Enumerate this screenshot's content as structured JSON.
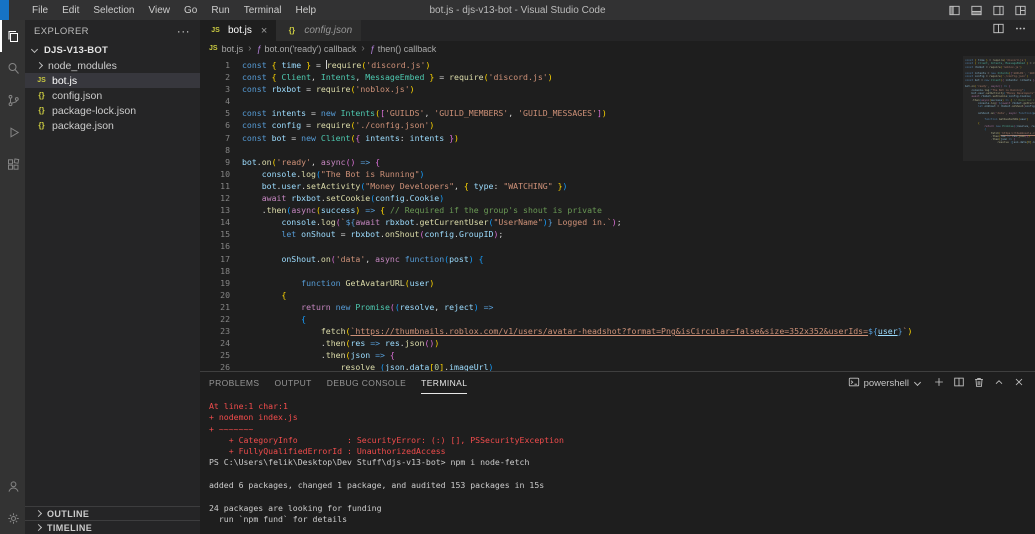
{
  "title_bar": {
    "title": "bot.js - djs-v13-bot - Visual Studio Code",
    "menus": [
      "File",
      "Edit",
      "Selection",
      "View",
      "Go",
      "Run",
      "Terminal",
      "Help"
    ]
  },
  "activity_bar": {
    "items": [
      "explorer",
      "search",
      "source-control",
      "run-and-debug",
      "extensions"
    ],
    "bottom_items": [
      "account",
      "settings"
    ],
    "active": "explorer"
  },
  "explorer": {
    "header": "EXPLORER",
    "root": "DJS-V13-BOT",
    "files": [
      {
        "label": "node_modules",
        "icon": "chevron",
        "selected": false
      },
      {
        "label": "bot.js",
        "icon": "js",
        "selected": true
      },
      {
        "label": "config.json",
        "icon": "json",
        "selected": false
      },
      {
        "label": "package-lock.json",
        "icon": "json",
        "selected": false
      },
      {
        "label": "package.json",
        "icon": "json",
        "selected": false
      }
    ],
    "bottom_sections": [
      "OUTLINE",
      "TIMELINE"
    ]
  },
  "tabs": [
    {
      "label": "bot.js",
      "icon": "js",
      "active": true
    },
    {
      "label": "config.json",
      "icon": "json",
      "active": false
    }
  ],
  "breadcrumb": [
    "bot.js",
    "bot.on('ready') callback",
    "then() callback"
  ],
  "editor": {
    "lines": [
      {
        "n": 1,
        "indent": 0,
        "tokens": [
          [
            "kw",
            "const "
          ],
          [
            "b1",
            "{"
          ],
          [
            "var",
            " time "
          ],
          [
            "b1",
            "}"
          ],
          [
            "pl",
            " = "
          ],
          [
            "cur",
            ""
          ],
          [
            "fn",
            "require"
          ],
          [
            "b1",
            "("
          ],
          [
            "str",
            "'discord.js'"
          ],
          [
            "b1",
            ")"
          ]
        ]
      },
      {
        "n": 2,
        "indent": 0,
        "tokens": [
          [
            "kw",
            "const "
          ],
          [
            "b1",
            "{"
          ],
          [
            "pl",
            " "
          ],
          [
            "cls",
            "Client"
          ],
          [
            "pl",
            ", "
          ],
          [
            "cls",
            "Intents"
          ],
          [
            "pl",
            ", "
          ],
          [
            "cls",
            "MessageEmbed"
          ],
          [
            "pl",
            " "
          ],
          [
            "b1",
            "}"
          ],
          [
            "pl",
            " = "
          ],
          [
            "fn",
            "require"
          ],
          [
            "b1",
            "("
          ],
          [
            "str",
            "'discord.js'"
          ],
          [
            "b1",
            ")"
          ]
        ]
      },
      {
        "n": 3,
        "indent": 0,
        "tokens": [
          [
            "kw",
            "const "
          ],
          [
            "var",
            "rbxbot"
          ],
          [
            "pl",
            " = "
          ],
          [
            "fn",
            "require"
          ],
          [
            "b1",
            "("
          ],
          [
            "str",
            "'noblox.js'"
          ],
          [
            "b1",
            ")"
          ]
        ]
      },
      {
        "n": 4,
        "indent": 0,
        "tokens": []
      },
      {
        "n": 5,
        "indent": 0,
        "tokens": [
          [
            "kw",
            "const "
          ],
          [
            "var",
            "intents"
          ],
          [
            "pl",
            " = "
          ],
          [
            "kw",
            "new "
          ],
          [
            "cls",
            "Intents"
          ],
          [
            "b1",
            "("
          ],
          [
            "b2",
            "["
          ],
          [
            "str",
            "'GUILDS'"
          ],
          [
            "pl",
            ", "
          ],
          [
            "str",
            "'GUILD_MEMBERS'"
          ],
          [
            "pl",
            ", "
          ],
          [
            "str",
            "'GUILD_MESSAGES'"
          ],
          [
            "b2",
            "]"
          ],
          [
            "b1",
            ")"
          ]
        ]
      },
      {
        "n": 6,
        "indent": 0,
        "tokens": [
          [
            "kw",
            "const "
          ],
          [
            "var",
            "config"
          ],
          [
            "pl",
            " = "
          ],
          [
            "fn",
            "require"
          ],
          [
            "b1",
            "("
          ],
          [
            "str",
            "'./config.json'"
          ],
          [
            "b1",
            ")"
          ]
        ]
      },
      {
        "n": 7,
        "indent": 0,
        "tokens": [
          [
            "kw",
            "const "
          ],
          [
            "var",
            "bot"
          ],
          [
            "pl",
            " = "
          ],
          [
            "kw",
            "new "
          ],
          [
            "cls",
            "Client"
          ],
          [
            "b1",
            "("
          ],
          [
            "b2",
            "{"
          ],
          [
            "var",
            " intents"
          ],
          [
            "pl",
            ": "
          ],
          [
            "var",
            "intents"
          ],
          [
            "pl",
            " "
          ],
          [
            "b2",
            "}"
          ],
          [
            "b1",
            ")"
          ]
        ]
      },
      {
        "n": 8,
        "indent": 0,
        "tokens": []
      },
      {
        "n": 9,
        "indent": 0,
        "tokens": [
          [
            "var",
            "bot"
          ],
          [
            "pl",
            "."
          ],
          [
            "fn",
            "on"
          ],
          [
            "b1",
            "("
          ],
          [
            "str",
            "'ready'"
          ],
          [
            "pl",
            ", "
          ],
          [
            "ctl",
            "async"
          ],
          [
            "b2",
            "("
          ],
          [
            "b2",
            ")"
          ],
          [
            "kw",
            " => "
          ],
          [
            "b2",
            "{"
          ]
        ]
      },
      {
        "n": 10,
        "indent": 4,
        "tokens": [
          [
            "var",
            "console"
          ],
          [
            "pl",
            "."
          ],
          [
            "fn",
            "log"
          ],
          [
            "b3",
            "("
          ],
          [
            "str",
            "\"The Bot is Running\""
          ],
          [
            "b3",
            ")"
          ]
        ]
      },
      {
        "n": 11,
        "indent": 4,
        "tokens": [
          [
            "var",
            "bot"
          ],
          [
            "pl",
            "."
          ],
          [
            "var",
            "user"
          ],
          [
            "pl",
            "."
          ],
          [
            "fn",
            "setActivity"
          ],
          [
            "b3",
            "("
          ],
          [
            "str",
            "\"Money Developers\""
          ],
          [
            "pl",
            ", "
          ],
          [
            "b1",
            "{"
          ],
          [
            "var",
            " type"
          ],
          [
            "pl",
            ": "
          ],
          [
            "str",
            "\"WATCHING\""
          ],
          [
            "pl",
            " "
          ],
          [
            "b1",
            "}"
          ],
          [
            "b3",
            ")"
          ]
        ]
      },
      {
        "n": 12,
        "indent": 4,
        "tokens": [
          [
            "ctl",
            "await "
          ],
          [
            "var",
            "rbxbot"
          ],
          [
            "pl",
            "."
          ],
          [
            "fn",
            "setCookie"
          ],
          [
            "b3",
            "("
          ],
          [
            "var",
            "config"
          ],
          [
            "pl",
            "."
          ],
          [
            "var",
            "Cookie"
          ],
          [
            "b3",
            ")"
          ]
        ]
      },
      {
        "n": 13,
        "indent": 4,
        "tokens": [
          [
            "pl",
            "."
          ],
          [
            "fn",
            "then"
          ],
          [
            "b3",
            "("
          ],
          [
            "ctl",
            "async"
          ],
          [
            "b1",
            "("
          ],
          [
            "var",
            "success"
          ],
          [
            "b1",
            ")"
          ],
          [
            "kw",
            " => "
          ],
          [
            "b1",
            "{"
          ],
          [
            "cmt",
            " // Required if the group's shout is private"
          ]
        ]
      },
      {
        "n": 14,
        "indent": 8,
        "tokens": [
          [
            "var",
            "console"
          ],
          [
            "pl",
            "."
          ],
          [
            "fn",
            "log"
          ],
          [
            "b2",
            "("
          ],
          [
            "str",
            "`"
          ],
          [
            "te",
            "${"
          ],
          [
            "ctl",
            "await "
          ],
          [
            "var",
            "rbxbot"
          ],
          [
            "pl",
            "."
          ],
          [
            "fn",
            "getCurrentUser"
          ],
          [
            "b3",
            "("
          ],
          [
            "str",
            "\"UserName\""
          ],
          [
            "b3",
            ")"
          ],
          [
            "te",
            "}"
          ],
          [
            "str",
            " Logged in.`"
          ],
          [
            "b2",
            ")"
          ],
          [
            "pl",
            ";"
          ]
        ]
      },
      {
        "n": 15,
        "indent": 8,
        "tokens": [
          [
            "kw",
            "let "
          ],
          [
            "var",
            "onShout"
          ],
          [
            "pl",
            " = "
          ],
          [
            "var",
            "rbxbot"
          ],
          [
            "pl",
            "."
          ],
          [
            "fn",
            "onShout"
          ],
          [
            "b2",
            "("
          ],
          [
            "var",
            "config"
          ],
          [
            "pl",
            "."
          ],
          [
            "var",
            "GroupID"
          ],
          [
            "b2",
            ")"
          ],
          [
            "pl",
            ";"
          ]
        ]
      },
      {
        "n": 16,
        "indent": 0,
        "tokens": []
      },
      {
        "n": 17,
        "indent": 8,
        "tokens": [
          [
            "var",
            "onShout"
          ],
          [
            "pl",
            "."
          ],
          [
            "fn",
            "on"
          ],
          [
            "b2",
            "("
          ],
          [
            "str",
            "'data'"
          ],
          [
            "pl",
            ", "
          ],
          [
            "ctl",
            "async "
          ],
          [
            "kw",
            "function"
          ],
          [
            "b3",
            "("
          ],
          [
            "var",
            "post"
          ],
          [
            "b3",
            ")"
          ],
          [
            "pl",
            " "
          ],
          [
            "b3",
            "{"
          ]
        ]
      },
      {
        "n": 18,
        "indent": 0,
        "tokens": []
      },
      {
        "n": 19,
        "indent": 12,
        "tokens": [
          [
            "kw",
            "function "
          ],
          [
            "fn",
            "GetAvatarURL"
          ],
          [
            "b1",
            "("
          ],
          [
            "var",
            "user"
          ],
          [
            "b1",
            ")"
          ]
        ]
      },
      {
        "n": 20,
        "indent": 8,
        "tokens": [
          [
            "b1",
            "{"
          ]
        ]
      },
      {
        "n": 21,
        "indent": 12,
        "tokens": [
          [
            "ctl",
            "return "
          ],
          [
            "kw",
            "new "
          ],
          [
            "cls",
            "Promise"
          ],
          [
            "b2",
            "("
          ],
          [
            "b3",
            "("
          ],
          [
            "var",
            "resolve"
          ],
          [
            "pl",
            ", "
          ],
          [
            "var",
            "reject"
          ],
          [
            "b3",
            ")"
          ],
          [
            "kw",
            " =>"
          ]
        ]
      },
      {
        "n": 22,
        "indent": 12,
        "tokens": [
          [
            "b3",
            "{"
          ]
        ]
      },
      {
        "n": 23,
        "indent": 16,
        "tokens": [
          [
            "fn",
            "fetch"
          ],
          [
            "b1",
            "("
          ],
          [
            "strU",
            "`https://thumbnails.roblox.com/v1/users/avatar-headshot?format=Png&isCircular=false&size=352x352&userIds="
          ],
          [
            "te",
            "${"
          ],
          [
            "varU",
            "user"
          ],
          [
            "te",
            "}"
          ],
          [
            "str",
            "`"
          ],
          [
            "b1",
            ")"
          ]
        ]
      },
      {
        "n": 24,
        "indent": 16,
        "tokens": [
          [
            "pl",
            "."
          ],
          [
            "fn",
            "then"
          ],
          [
            "b1",
            "("
          ],
          [
            "var",
            "res"
          ],
          [
            "kw",
            " => "
          ],
          [
            "var",
            "res"
          ],
          [
            "pl",
            "."
          ],
          [
            "fn",
            "json"
          ],
          [
            "b2",
            "("
          ],
          [
            "b2",
            ")"
          ],
          [
            "b1",
            ")"
          ]
        ]
      },
      {
        "n": 25,
        "indent": 16,
        "tokens": [
          [
            "pl",
            "."
          ],
          [
            "fn",
            "then"
          ],
          [
            "b1",
            "("
          ],
          [
            "var",
            "json"
          ],
          [
            "kw",
            " => "
          ],
          [
            "b2",
            "{"
          ]
        ]
      },
      {
        "n": 26,
        "indent": 20,
        "tokens": [
          [
            "fn",
            "resolve"
          ],
          [
            "pl",
            " "
          ],
          [
            "b3",
            "("
          ],
          [
            "var",
            "json"
          ],
          [
            "pl",
            "."
          ],
          [
            "var",
            "data"
          ],
          [
            "b1",
            "["
          ],
          [
            "num",
            "0"
          ],
          [
            "b1",
            "]"
          ],
          [
            "pl",
            "."
          ],
          [
            "var",
            "imageUrl"
          ],
          [
            "b3",
            ")"
          ]
        ]
      }
    ]
  },
  "panel": {
    "tabs": [
      "PROBLEMS",
      "OUTPUT",
      "DEBUG CONSOLE",
      "TERMINAL"
    ],
    "active_tab": "TERMINAL",
    "shell_label": "powershell",
    "terminal_lines": [
      {
        "cls": "err",
        "text": "At line:1 char:1"
      },
      {
        "cls": "err",
        "text": "+ nodemon index.js"
      },
      {
        "cls": "err",
        "text": "+ ~~~~~~~"
      },
      {
        "cls": "err",
        "text": "    + CategoryInfo          : SecurityError: (:) [], PSSecurityException"
      },
      {
        "cls": "err",
        "text": "    + FullyQualifiedErrorId : UnauthorizedAccess"
      },
      {
        "cls": "out",
        "text": "PS C:\\Users\\felik\\Desktop\\Dev Stuff\\djs-v13-bot> npm i node-fetch"
      },
      {
        "cls": "out",
        "text": ""
      },
      {
        "cls": "out",
        "text": "added 6 packages, changed 1 package, and audited 153 packages in 15s"
      },
      {
        "cls": "out",
        "text": ""
      },
      {
        "cls": "out",
        "text": "24 packages are looking for funding"
      },
      {
        "cls": "out",
        "text": "  run `npm fund` for details"
      }
    ]
  }
}
